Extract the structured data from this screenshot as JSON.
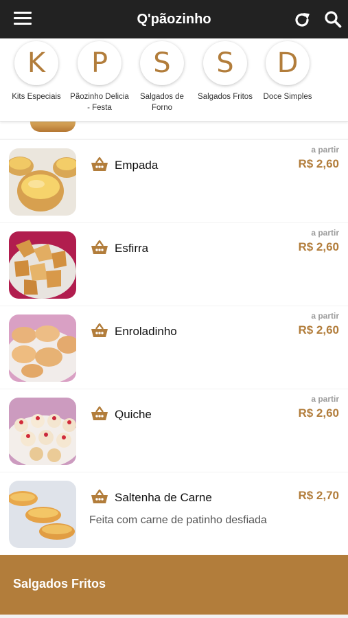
{
  "header": {
    "title": "Q'pãozinho",
    "menu_icon": "hamburger-menu-icon",
    "refresh_icon": "refresh-icon",
    "search_icon": "search-icon"
  },
  "categories": [
    {
      "letter": "K",
      "label": "Kits Especiais"
    },
    {
      "letter": "P",
      "label": "Pãozinho Delicia - Festa"
    },
    {
      "letter": "S",
      "label": "Salgados de Forno"
    },
    {
      "letter": "S",
      "label": "Salgados Fritos"
    },
    {
      "letter": "D",
      "label": "Doce Simples"
    }
  ],
  "products": [
    {
      "name": "Empada",
      "from_label": "a partir",
      "price": "R$ 2,60"
    },
    {
      "name": "Esfirra",
      "from_label": "a partir",
      "price": "R$ 2,60"
    },
    {
      "name": "Enroladinho",
      "from_label": "a partir",
      "price": "R$ 2,60"
    },
    {
      "name": "Quiche",
      "from_label": "a partir",
      "price": "R$ 2,60"
    },
    {
      "name": "Saltenha de Carne",
      "price": "R$ 2,70",
      "description": "Feita com carne de patinho desfiada"
    }
  ],
  "footer": {
    "section_label": "Salgados Fritos"
  },
  "colors": {
    "accent": "#b27d3b",
    "topbar": "#222222",
    "list_background": "#f2f2f2"
  }
}
